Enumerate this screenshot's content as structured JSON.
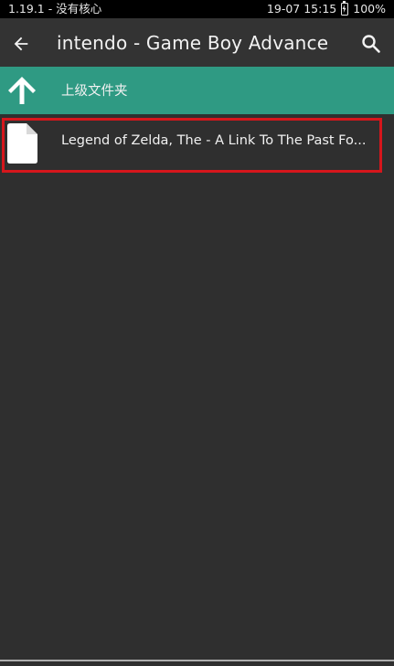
{
  "status_bar": {
    "left_text": "1.19.1 - 没有核心",
    "right_time": "19-07 15:15",
    "battery_percent": "100%"
  },
  "toolbar": {
    "title": "intendo - Game Boy Advance ",
    "back_icon": "arrow-left-icon",
    "search_icon": "search-icon"
  },
  "list": {
    "parent_folder": {
      "label": "上级文件夹",
      "icon": "arrow-up-icon"
    },
    "items": [
      {
        "label": "Legend of Zelda, The - A Link To The Past Fo...",
        "icon": "file-icon"
      }
    ]
  },
  "colors": {
    "accent": "#2f9a83",
    "highlight": "#d6161c",
    "background": "#2f2f2f",
    "toolbar": "#333333"
  }
}
